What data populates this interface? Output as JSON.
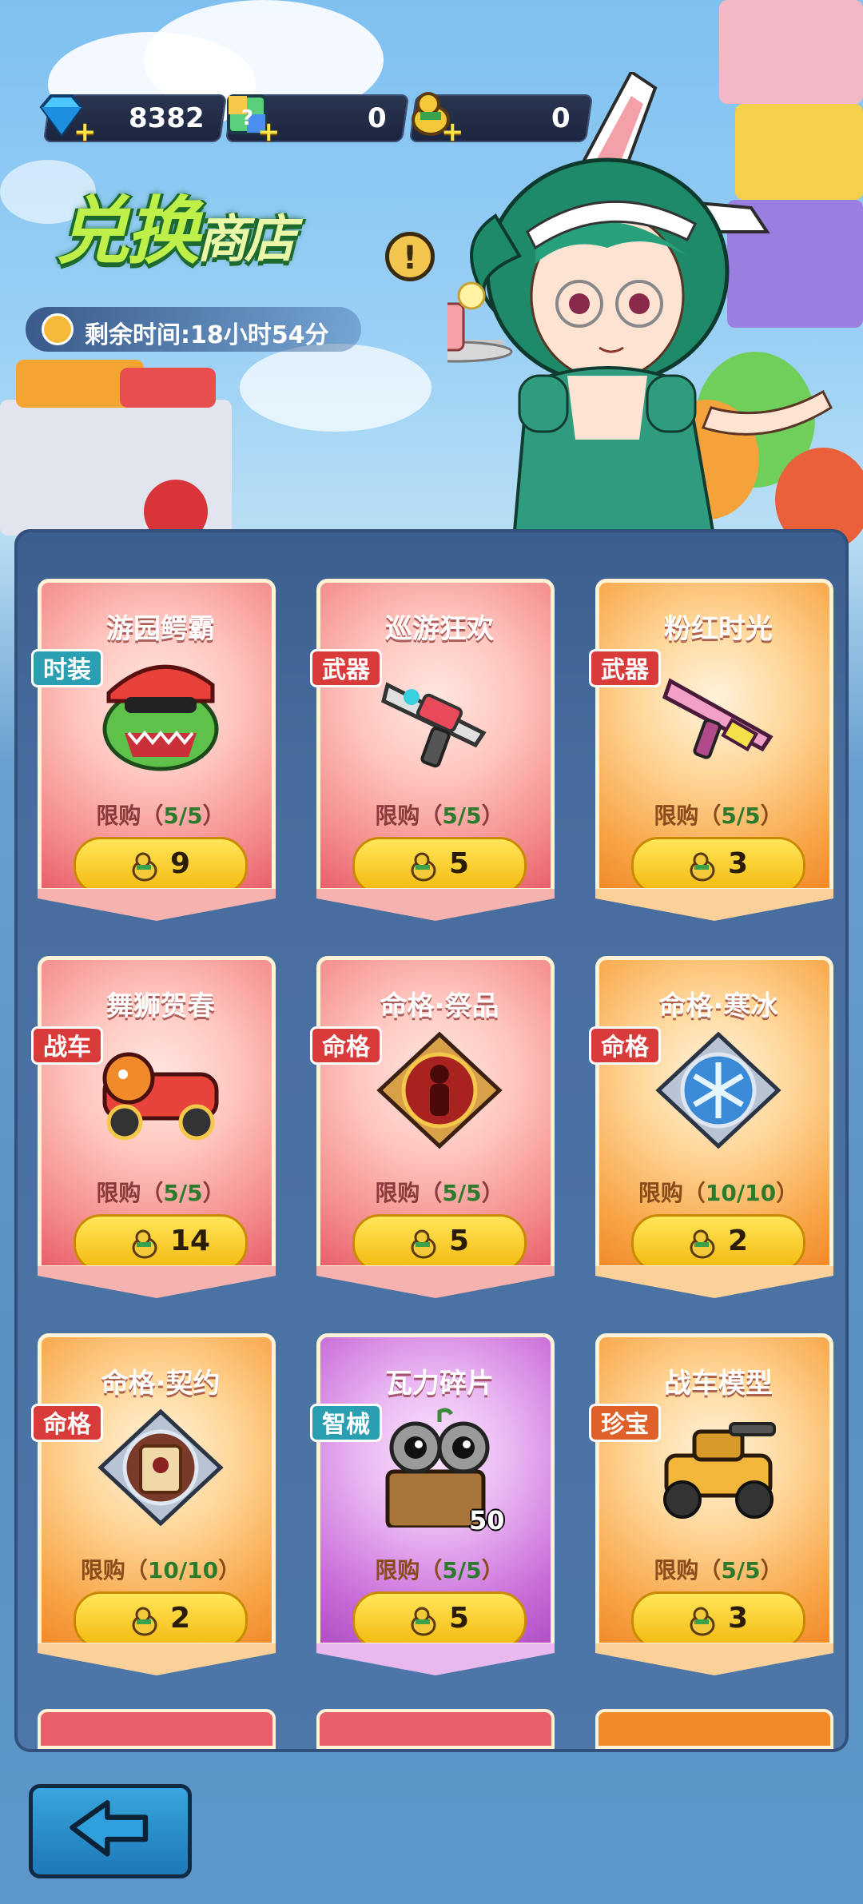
{
  "currencies": [
    {
      "icon": "diamond-icon",
      "value": "8382"
    },
    {
      "icon": "lucky-box-icon",
      "value": "0"
    },
    {
      "icon": "duck-coin-icon",
      "value": "0"
    }
  ],
  "title": {
    "main": "兑换",
    "sub": "商店"
  },
  "timer": {
    "text": "剩余时间:18小时54分"
  },
  "items": [
    {
      "name": "游园鳄霸",
      "tag": "时装",
      "limit_label": "限购",
      "limit": "5/5",
      "cost": "9",
      "icon": "crocodile-costume-icon",
      "theme": "red"
    },
    {
      "name": "巡游狂欢",
      "tag": "武器",
      "limit_label": "限购",
      "limit": "5/5",
      "cost": "5",
      "icon": "carnival-gun-icon",
      "theme": "red"
    },
    {
      "name": "粉红时光",
      "tag": "武器",
      "limit_label": "限购",
      "limit": "5/5",
      "cost": "3",
      "icon": "pink-gun-icon",
      "theme": "orange"
    },
    {
      "name": "舞狮贺春",
      "tag": "战车",
      "limit_label": "限购",
      "limit": "5/5",
      "cost": "14",
      "icon": "lion-dance-vehicle-icon",
      "theme": "red"
    },
    {
      "name": "命格·祭品",
      "tag": "命格",
      "limit_label": "限购",
      "limit": "5/5",
      "cost": "5",
      "icon": "offering-badge-icon",
      "theme": "red"
    },
    {
      "name": "命格·寒冰",
      "tag": "命格",
      "limit_label": "限购",
      "limit": "10/10",
      "cost": "2",
      "icon": "ice-badge-icon",
      "theme": "orange"
    },
    {
      "name": "命格·契约",
      "tag": "命格",
      "limit_label": "限购",
      "limit": "10/10",
      "cost": "2",
      "icon": "contract-badge-icon",
      "theme": "orange"
    },
    {
      "name": "瓦力碎片",
      "tag": "智械",
      "limit_label": "限购",
      "limit": "5/5",
      "cost": "5",
      "icon": "walle-robot-icon",
      "theme": "purple",
      "quantity": "50"
    },
    {
      "name": "战车模型",
      "tag": "珍宝",
      "limit_label": "限购",
      "limit": "5/5",
      "cost": "3",
      "icon": "tank-model-icon",
      "theme": "orange"
    }
  ],
  "back_button": {
    "icon": "back-arrow-icon"
  }
}
